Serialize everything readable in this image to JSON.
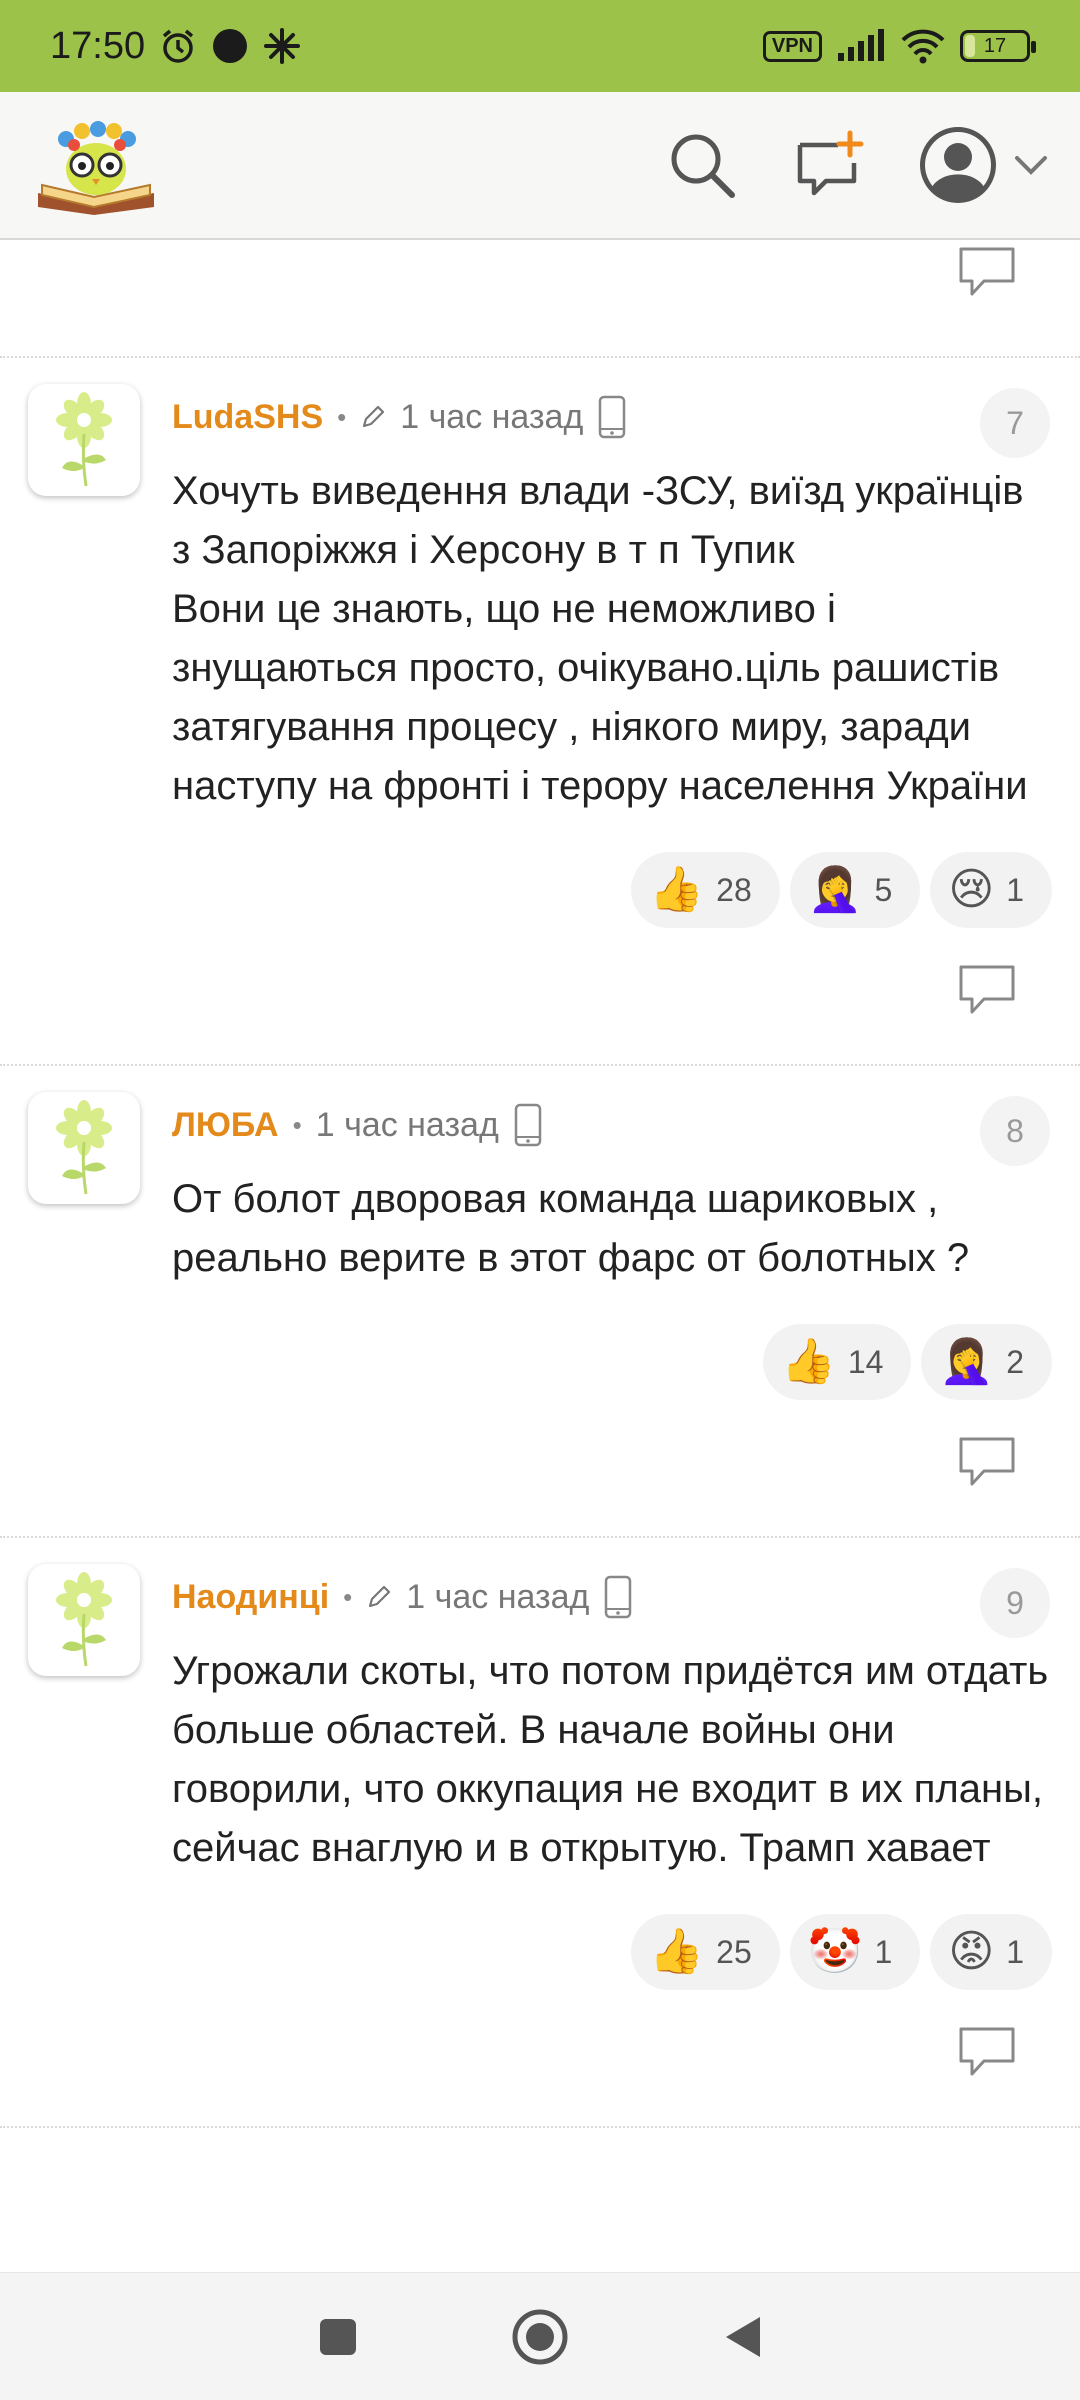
{
  "status_bar": {
    "time": "17:50",
    "vpn": "VPN",
    "battery": "17",
    "battery_fraction": 0.17,
    "bg_color": "#9cc24a"
  },
  "header": {
    "logo": "book-owl-logo",
    "icons": [
      "search-icon",
      "new-comment-icon",
      "profile-icon",
      "chevron-down-icon"
    ]
  },
  "comments": [
    {
      "username": "LudaSHS",
      "edited": true,
      "time": "1 час назад",
      "device": "mobile-icon",
      "number": "7",
      "text": "Хочуть виведення влади -ЗСУ, виїзд українців з Запоріжжя і Херсону в т п Тупик\nВони це знають, що не неможливо і знущаються просто, очікувано.ціль рашистів затягування процесу , ніякого миру, заради наступу на фронті і терору населення України",
      "reactions": [
        {
          "emoji": "👍",
          "count": "28"
        },
        {
          "emoji": "🤦‍♀️",
          "count": "5"
        },
        {
          "emoji": "😢",
          "count": "1"
        }
      ]
    },
    {
      "username": "ЛЮБА",
      "edited": false,
      "time": "1 час назад",
      "device": "mobile-icon",
      "number": "8",
      "text": "От болот дворовая команда шариковых , реально верите в этот фарс от болотных ?",
      "reactions": [
        {
          "emoji": "👍",
          "count": "14"
        },
        {
          "emoji": "🤦‍♀️",
          "count": "2"
        }
      ]
    },
    {
      "username": "Наодинці",
      "edited": true,
      "time": "1 час назад",
      "device": "mobile-icon",
      "number": "9",
      "text": "Угрожали скоты, что потом придётся им отдать больше областей. В начале войны они говорили, что оккупация не входит в их планы, сейчас внаглую и в открытую. Трамп хавает",
      "reactions": [
        {
          "emoji": "👍",
          "count": "25"
        },
        {
          "emoji": "🤡",
          "count": "1"
        },
        {
          "emoji": "😡",
          "count": "1"
        }
      ]
    }
  ],
  "nav": [
    "recents-button",
    "home-button",
    "back-button"
  ]
}
